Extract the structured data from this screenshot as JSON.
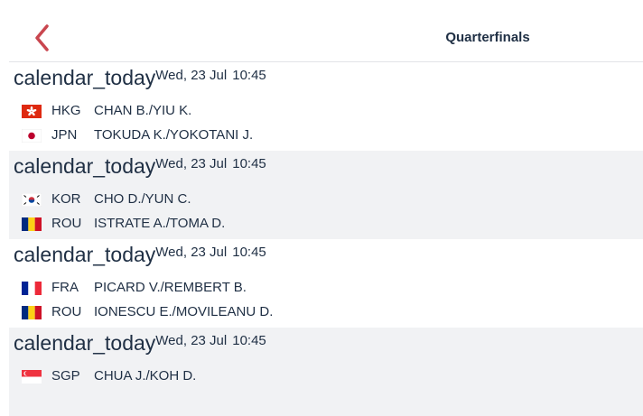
{
  "header": {
    "title": "Quarterfinals",
    "back_icon": "chevron-left-icon",
    "accent_color": "#c9464f"
  },
  "matches": [
    {
      "calendar_icon_text": "calendar_today",
      "date": "Wed, 23 Jul",
      "time": "10:45",
      "team1": {
        "code": "HKG",
        "players": "CHAN B./YIU K.",
        "flag": "hong-kong-flag"
      },
      "team2": {
        "code": "JPN",
        "players": "TOKUDA K./YOKOTANI J.",
        "flag": "japan-flag"
      }
    },
    {
      "calendar_icon_text": "calendar_today",
      "date": "Wed, 23 Jul",
      "time": "10:45",
      "team1": {
        "code": "KOR",
        "players": "CHO D./YUN C.",
        "flag": "korea-flag"
      },
      "team2": {
        "code": "ROU",
        "players": "ISTRATE A./TOMA D.",
        "flag": "romania-flag"
      }
    },
    {
      "calendar_icon_text": "calendar_today",
      "date": "Wed, 23 Jul",
      "time": "10:45",
      "team1": {
        "code": "FRA",
        "players": "PICARD V./REMBERT B.",
        "flag": "france-flag"
      },
      "team2": {
        "code": "ROU",
        "players": "IONESCU E./MOVILEANU D.",
        "flag": "romania-flag"
      }
    },
    {
      "calendar_icon_text": "calendar_today",
      "date": "Wed, 23 Jul",
      "time": "10:45",
      "team1": {
        "code": "SGP",
        "players": "CHUA J./KOH D.",
        "flag": "singapore-flag"
      }
    }
  ]
}
